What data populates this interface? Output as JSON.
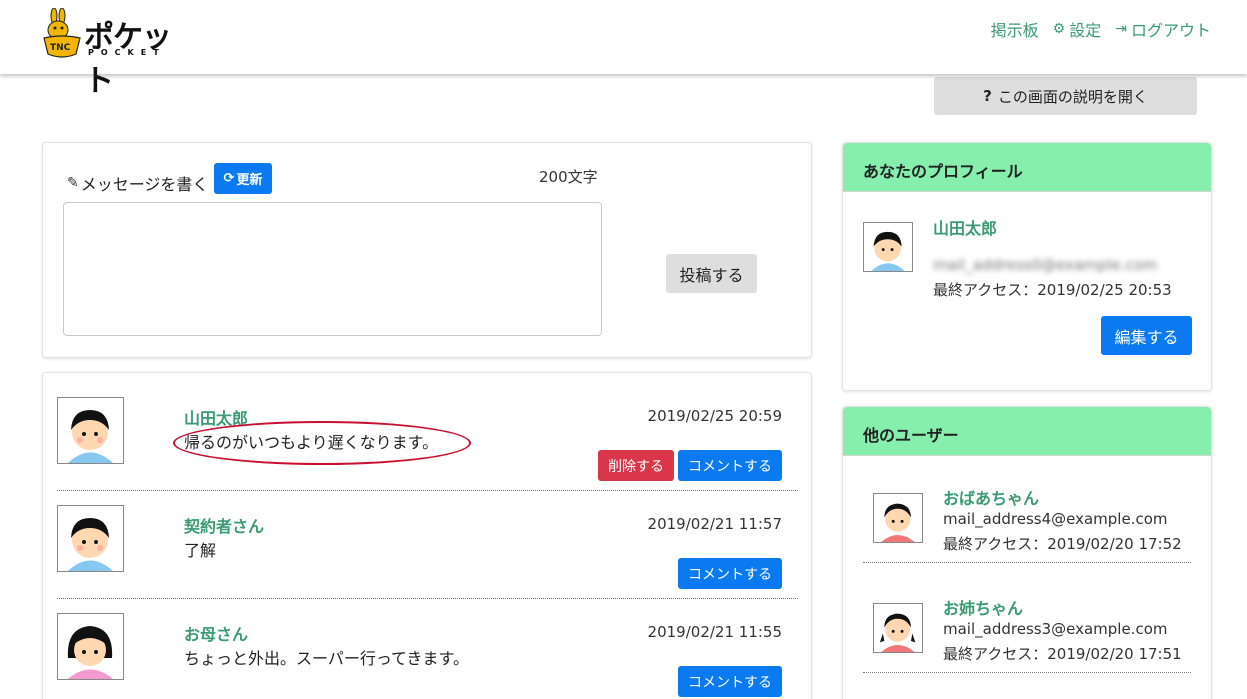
{
  "brand": {
    "name": "ポケット",
    "sub": "POCKET",
    "badge": "TNC"
  },
  "nav": [
    {
      "label": "掲示板",
      "icon": ""
    },
    {
      "label": "設定",
      "icon": "⚙"
    },
    {
      "label": "ログアウト",
      "icon": "⇥"
    }
  ],
  "help": {
    "label": "この画面の説明を開く",
    "icon": "?"
  },
  "compose": {
    "label": "メッセージを書く",
    "refresh_label": "更新",
    "char_count": "200文字",
    "textarea_value": "",
    "post_label": "投稿する"
  },
  "messages": [
    {
      "name": "山田太郎",
      "date": "2019/02/25 20:59",
      "body": "帰るのがいつもより遅くなります。",
      "delete_label": "削除する",
      "comment_label": "コメントする",
      "avatar": "boy"
    },
    {
      "name": "契約者さん",
      "date": "2019/02/21 11:57",
      "body": "了解",
      "comment_label": "コメントする",
      "avatar": "boy"
    },
    {
      "name": "お母さん",
      "date": "2019/02/21 11:55",
      "body": "ちょっと外出。スーパー行ってきます。",
      "comment_label": "コメントする",
      "avatar": "girl"
    }
  ],
  "profile": {
    "title": "あなたのプロフィール",
    "name": "山田太郎",
    "email": "mail_address0@example.com",
    "last_access": "最終アクセス：2019/02/25 20:53",
    "edit_label": "編集する"
  },
  "others": {
    "title": "他のユーザー",
    "users": [
      {
        "name": "おばあちゃん",
        "email": "mail_address4@example.com",
        "last_access": "最終アクセス：2019/02/20 17:52"
      },
      {
        "name": "お姉ちゃん",
        "email": "mail_address3@example.com",
        "last_access": "最終アクセス：2019/02/20 17:51"
      }
    ]
  },
  "colors": {
    "accent_green": "#3a9a73",
    "header_green": "#86efae",
    "primary_blue": "#0b7af0",
    "danger_red": "#d9364a",
    "annotation_red": "#c8102e"
  }
}
